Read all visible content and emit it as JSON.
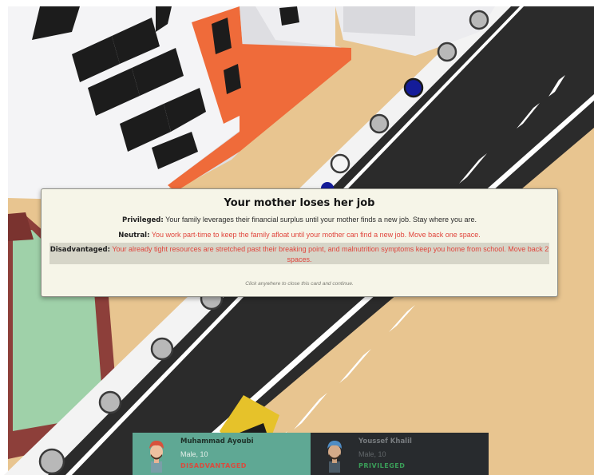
{
  "event_card": {
    "title": "Your mother loses her job",
    "privileged_label": "Privileged:",
    "privileged_text": "Your family leverages their financial surplus until your mother finds a new job. Stay where you are.",
    "neutral_label": "Neutral:",
    "neutral_text": "You work part-time to keep the family afloat until your mother can find a new job. Move back one space.",
    "disadvantaged_label": "Disadvantaged:",
    "disadvantaged_text": "Your already tight resources are stretched past their breaking point, and malnutrition symptoms keep you home from school. Move back 2 spaces.",
    "hint": "Click anywhere to close this card and continue."
  },
  "players": [
    {
      "name": "Muhammad Ayoubi",
      "info": "Male, 10",
      "status": "DISADVANTAGED",
      "status_color": "#d94b3e",
      "active": true
    },
    {
      "name": "Youssef Khalil",
      "info": "Male, 10",
      "status": "PRIVILEGED",
      "status_color": "#3a9d58",
      "active": false
    }
  ],
  "colors": {
    "ground": "#e8c590",
    "road": "#2b2b2b",
    "sidewalk": "#f2f2f2",
    "building": "#f4f4f6",
    "building_accent": "#ef6b3a",
    "space_marker": "#b8b8b8",
    "current_space": "#141c99"
  }
}
